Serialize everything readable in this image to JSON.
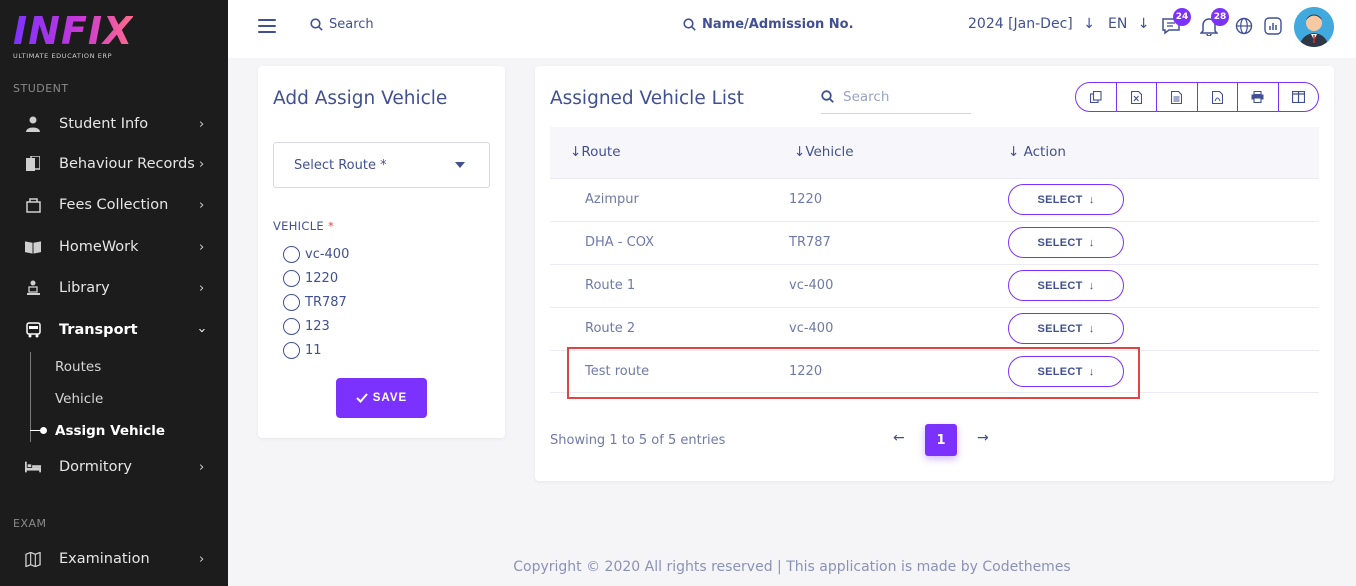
{
  "logo": {
    "brand": "INFIX",
    "tagline": "ULTIMATE EDUCATION ERP"
  },
  "sidebar": {
    "section_student": "STUDENT",
    "items": [
      {
        "label": "Student Info",
        "icon": "user-icon"
      },
      {
        "label": "Behaviour Records",
        "icon": "records-icon"
      },
      {
        "label": "Fees Collection",
        "icon": "fees-icon"
      },
      {
        "label": "HomeWork",
        "icon": "book-icon"
      },
      {
        "label": "Library",
        "icon": "library-icon"
      },
      {
        "label": "Transport",
        "icon": "bus-icon",
        "expanded": true
      },
      {
        "label": "Dormitory",
        "icon": "bed-icon"
      }
    ],
    "transport_sub": [
      {
        "label": "Routes"
      },
      {
        "label": "Vehicle"
      },
      {
        "label": "Assign Vehicle",
        "active": true
      }
    ],
    "section_exam": "EXAM",
    "exam_items": [
      {
        "label": "Examination",
        "icon": "map-icon"
      }
    ]
  },
  "header": {
    "search_label": "Search",
    "admission_search_label": "Name/Admission No.",
    "academic_year": "2024 [Jan-Dec]",
    "language": "EN",
    "chat_badge": "24",
    "notification_badge": "28"
  },
  "assign_form": {
    "title": "Add Assign Vehicle",
    "route_placeholder": "Select Route *",
    "vehicle_label": "VEHICLE",
    "required_mark": "*",
    "vehicles": [
      "vc-400",
      "1220",
      "TR787",
      "123",
      "11"
    ],
    "save_label": "SAVE"
  },
  "vehicle_list": {
    "title": "Assigned Vehicle List",
    "search_placeholder": "Search",
    "columns": [
      "Route",
      "Vehicle",
      "Action"
    ],
    "rows": [
      {
        "route": "Azimpur",
        "vehicle": "1220"
      },
      {
        "route": "DHA - COX",
        "vehicle": "TR787"
      },
      {
        "route": "Route 1",
        "vehicle": "vc-400"
      },
      {
        "route": "Route 2",
        "vehicle": "vc-400"
      },
      {
        "route": "Test route",
        "vehicle": "1220"
      }
    ],
    "action_label": "SELECT",
    "showing_text": "Showing 1 to 5 of 5 entries",
    "current_page": "1"
  },
  "footer": {
    "text": "Copyright © 2020 All rights reserved | This application is made by Codethemes"
  },
  "colors": {
    "accent": "#7c32ff",
    "text": "#415094",
    "sidebar_bg": "#1c1c1c",
    "highlight": "#e04545"
  }
}
